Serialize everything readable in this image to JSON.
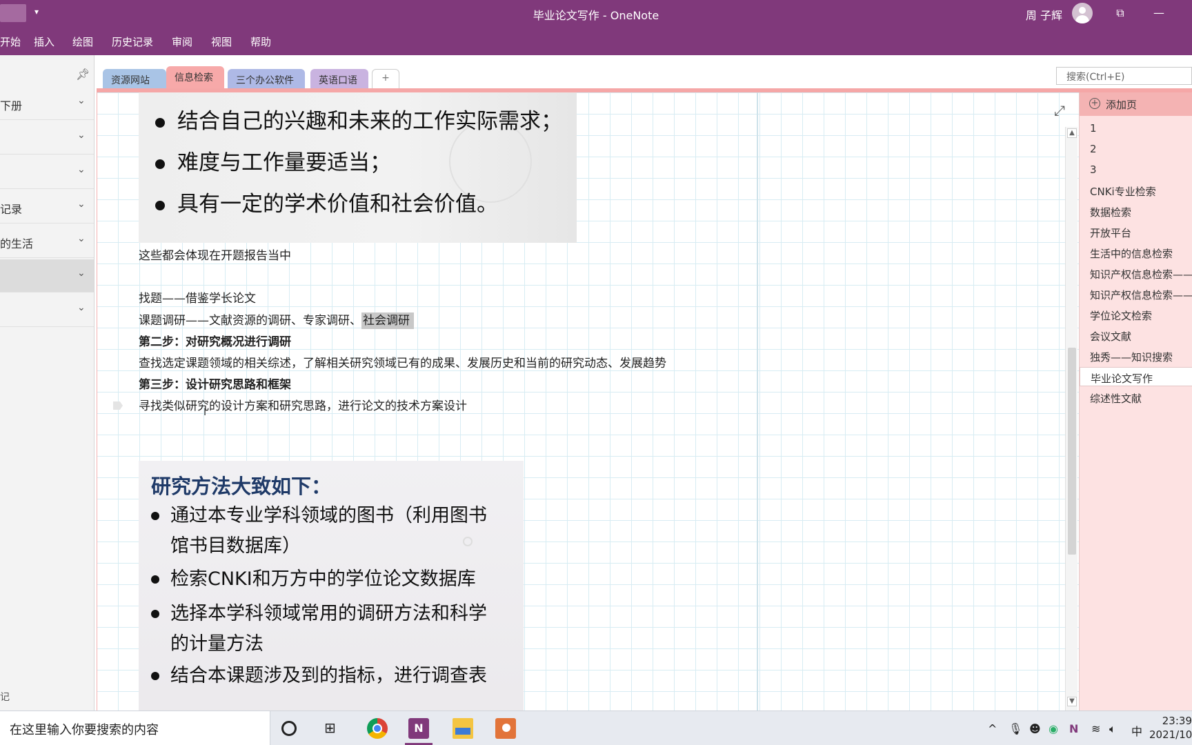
{
  "window": {
    "title": "毕业论文写作 - OneNote",
    "user": "周 子辉",
    "restore_icon": "restore-icon",
    "minimize_icon": "minimize-icon"
  },
  "menu": [
    "开始",
    "插入",
    "绘图",
    "历史记录",
    "审阅",
    "视图",
    "帮助"
  ],
  "sidebar": {
    "sections": [
      "下册",
      "",
      "",
      "记录",
      "的生活",
      "",
      ""
    ],
    "footer": "记"
  },
  "tabs": [
    {
      "label": "资源网站",
      "color": "#a9c4e6"
    },
    {
      "label": "信息检索",
      "color": "#f7a9a9"
    },
    {
      "label": "三个办公软件",
      "color": "#aeb9e6"
    },
    {
      "label": "英语口语",
      "color": "#c9b3e0"
    },
    {
      "label": "+",
      "color": "#ffffff"
    }
  ],
  "search": {
    "placeholder": "搜索(Ctrl+E)"
  },
  "page": {
    "image1_bullets": [
      "结合自己的兴趣和未来的工作实际需求；",
      "难度与工作量要适当；",
      "具有一定的学术价值和社会价值。"
    ],
    "line1": "这些都会体现在开题报告当中",
    "line2": "找题——借鉴学长论文",
    "line3_a": "课题调研——文献资源的调研、专家调研、",
    "line3_b": "社会调研",
    "line4": "第二步：对研究概况进行调研",
    "line5": "查找选定课题领域的相关综述，了解相关研究领域已有的成果、发展历史和当前的研究动态、发展趋势",
    "line6": "第三步：设计研究思路和框架",
    "line7": "寻找类似研究的设计方案和研究思路，进行论文的技术方案设计",
    "image2_heading": "研究方法大致如下：",
    "image2_bullets": [
      [
        "通过本专业学科领域的图书（利用图书",
        "馆书目数据库）"
      ],
      [
        "检索CNKI和万方中的学位论文数据库"
      ],
      [
        "选择本学科领域常用的调研方法和科学",
        "的计量方法"
      ],
      [
        "结合本课题涉及到的指标，进行调查表"
      ]
    ]
  },
  "pages": {
    "add_label": "添加页",
    "items": [
      "1",
      "2",
      "3",
      "CNKi专业检索",
      "数据检索",
      "开放平台",
      "生活中的信息检索",
      "知识产权信息检索——",
      "知识产权信息检索——",
      "学位论文检索",
      "会议文献",
      "独秀——知识搜索",
      "毕业论文写作",
      "综述性文献"
    ],
    "selected_index": 12
  },
  "taskbar": {
    "search_text": "在这里输入你要搜索的内容",
    "ime": "中",
    "time": "23:39",
    "date": "2021/10"
  }
}
